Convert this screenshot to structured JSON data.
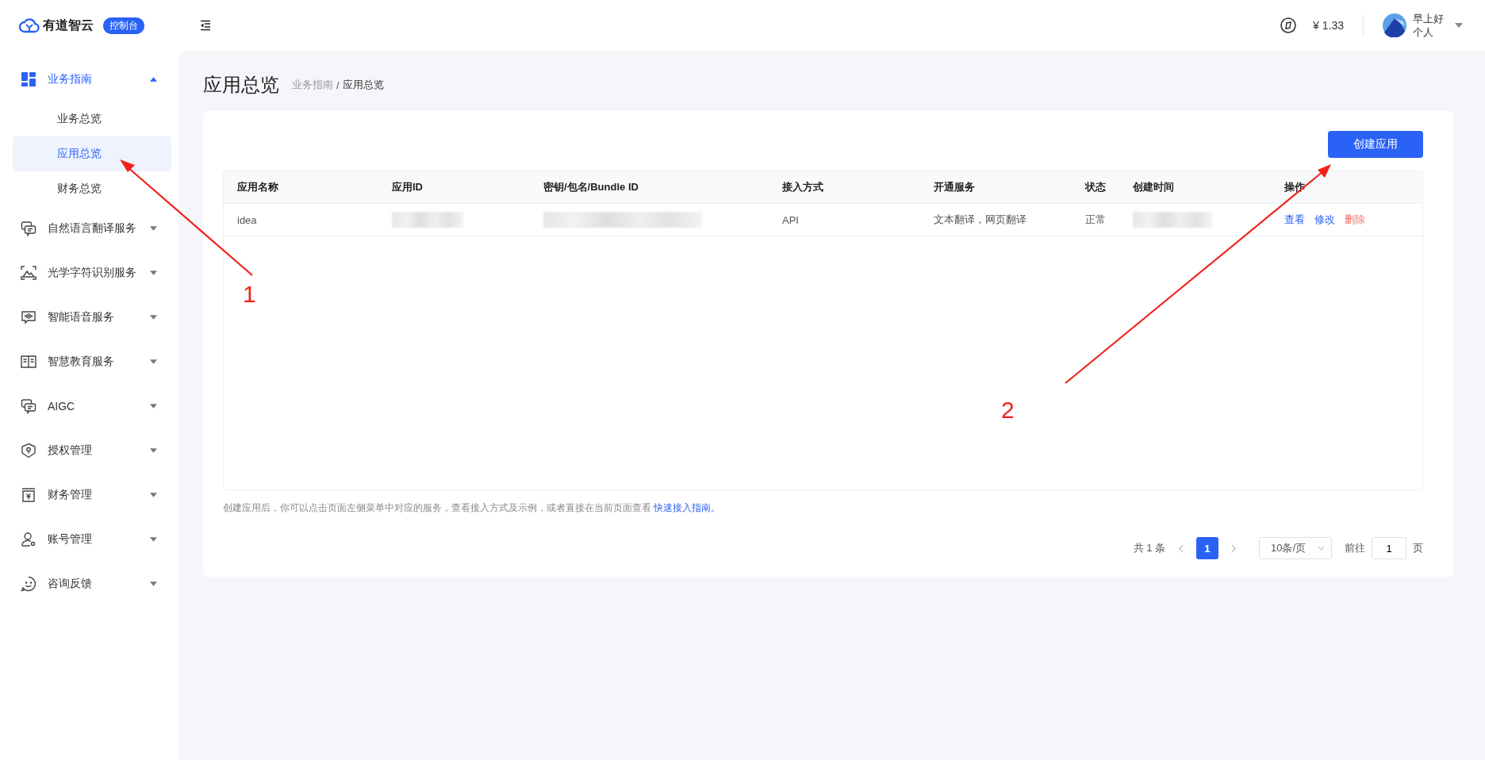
{
  "brand": {
    "name": "有道智云",
    "badge": "控制台"
  },
  "header": {
    "balance": "¥ 1.33",
    "greeting": "早上好",
    "account_type": "个人"
  },
  "sidebar": {
    "items": [
      {
        "label": "业务指南",
        "kind": "grid",
        "expanded": true,
        "children": [
          {
            "label": "业务总览",
            "selected": false
          },
          {
            "label": "应用总览",
            "selected": true
          },
          {
            "label": "财务总览",
            "selected": false
          }
        ]
      },
      {
        "label": "自然语言翻译服务",
        "kind": "chat",
        "expanded": false
      },
      {
        "label": "光学字符识别服务",
        "kind": "scan",
        "expanded": false
      },
      {
        "label": "智能语音服务",
        "kind": "voice",
        "expanded": false
      },
      {
        "label": "智慧教育服务",
        "kind": "book",
        "expanded": false
      },
      {
        "label": "AIGC",
        "kind": "chat",
        "expanded": false
      },
      {
        "label": "授权管理",
        "kind": "shield",
        "expanded": false
      },
      {
        "label": "财务管理",
        "kind": "bill",
        "expanded": false
      },
      {
        "label": "账号管理",
        "kind": "user",
        "expanded": false
      },
      {
        "label": "咨询反馈",
        "kind": "smile",
        "expanded": false
      }
    ]
  },
  "page": {
    "title": "应用总览",
    "breadcrumb": {
      "parent": "业务指南",
      "separator": "/",
      "current": "应用总览"
    }
  },
  "create_button": "创建应用",
  "table": {
    "columns": [
      "应用名称",
      "应用ID",
      "密钥/包名/Bundle ID",
      "接入方式",
      "开通服务",
      "状态",
      "创建时间",
      "操作"
    ],
    "rows": [
      {
        "cells": [
          {
            "kind": "text",
            "text": "idea"
          },
          {
            "kind": "redacted"
          },
          {
            "kind": "redacted"
          },
          {
            "kind": "text",
            "text": "API"
          },
          {
            "kind": "text",
            "text": "文本翻译，网页翻译"
          },
          {
            "kind": "text",
            "text": "正常"
          },
          {
            "kind": "redacted"
          },
          {
            "kind": "actions",
            "actions": [
              {
                "label": "查看",
                "kind": "link"
              },
              {
                "label": "修改",
                "kind": "link"
              },
              {
                "label": "删除",
                "kind": "danger"
              }
            ]
          }
        ]
      }
    ]
  },
  "note": {
    "text": "创建应用后，你可以点击页面左侧菜单中对应的服务，查看接入方式及示例，或者直接在当前页面查看",
    "link": "快速接入指南。"
  },
  "pagination": {
    "total": "共 1 条",
    "pages": [
      {
        "label": "1",
        "selected": true
      }
    ],
    "page_size": "10条/页",
    "goto_label": "前往",
    "goto_value": "1",
    "goto_suffix": "页"
  },
  "annotations": [
    {
      "label": "1"
    },
    {
      "label": "2"
    }
  ]
}
